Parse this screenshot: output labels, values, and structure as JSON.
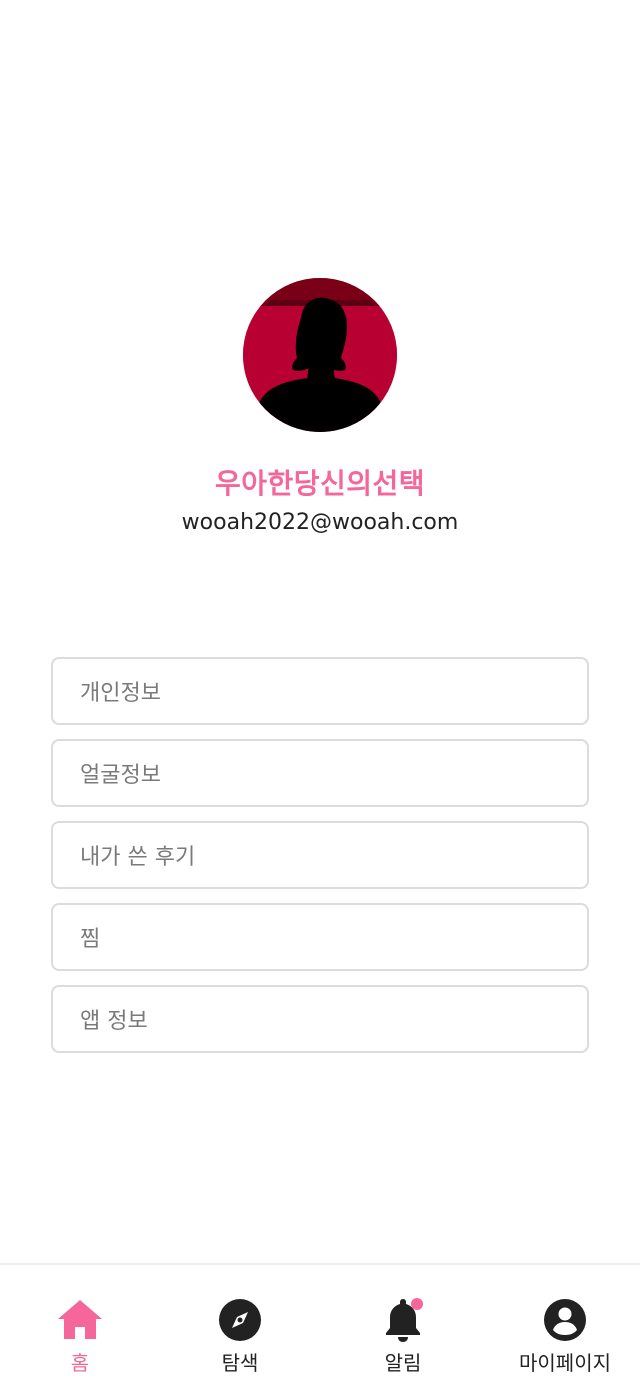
{
  "profile": {
    "nickname": "우아한당신의선택",
    "email": "wooah2022@wooah.com",
    "avatar_icon": "person-silhouette-icon"
  },
  "menu": {
    "items": [
      {
        "label": "개인정보"
      },
      {
        "label": "얼굴정보"
      },
      {
        "label": "내가 쓴 후기"
      },
      {
        "label": "찜"
      },
      {
        "label": "앱 정보"
      }
    ]
  },
  "tabbar": {
    "active": "home",
    "tabs": [
      {
        "id": "home",
        "label": "홈",
        "icon": "home-icon"
      },
      {
        "id": "explore",
        "label": "탐색",
        "icon": "compass-icon"
      },
      {
        "id": "notifications",
        "label": "알림",
        "icon": "bell-icon",
        "has_badge": true
      },
      {
        "id": "mypage",
        "label": "마이페이지",
        "icon": "account-circle-icon"
      }
    ]
  },
  "colors": {
    "accent": "#f5679a",
    "avatar_bg": "#b80032",
    "text_primary": "#222222",
    "text_menu": "#7a7a7a",
    "border": "#dcdcdc"
  }
}
